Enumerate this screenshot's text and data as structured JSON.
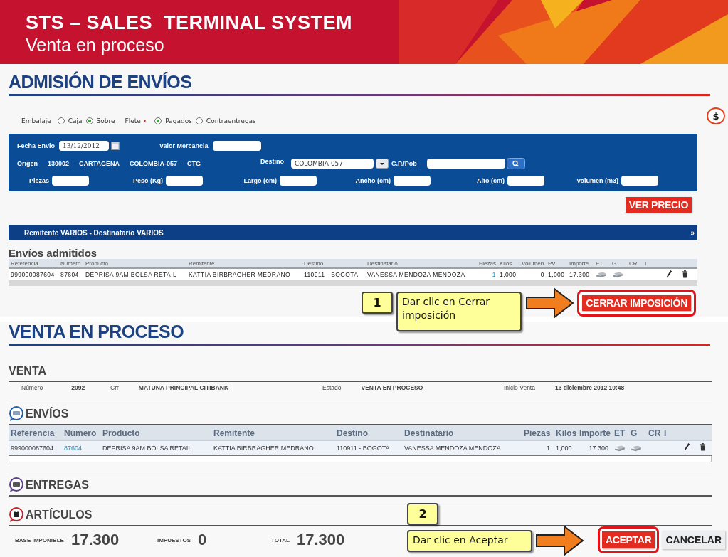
{
  "header": {
    "title": "STS – SALES  TERMINAL SYSTEM",
    "subtitle": "Venta en proceso"
  },
  "admision": {
    "heading": "ADMISIÓN DE ENVÍOS",
    "options": [
      {
        "label": "Embalaje",
        "choices": [
          {
            "label": "Caja",
            "selected": false
          },
          {
            "label": "Sobre",
            "selected": true
          }
        ]
      },
      {
        "label": "Flete",
        "marker": "•",
        "choices": [
          {
            "label": "Pagados",
            "selected": true
          },
          {
            "label": "Contraentregas",
            "selected": false
          }
        ]
      }
    ],
    "price_icon": "$",
    "form": {
      "row_1": [
        {
          "kind": "label",
          "text": "Fecha Envio"
        },
        {
          "kind": "date",
          "value": "13/12/2012"
        },
        {
          "kind": "label",
          "text": "Valor Mercancia"
        },
        {
          "kind": "field"
        }
      ],
      "row_2": [
        {
          "kind": "label",
          "text": "Origen"
        },
        {
          "kind": "value",
          "text": "130002"
        },
        {
          "kind": "value",
          "text": "CARTAGENA"
        },
        {
          "kind": "value",
          "text": "COLOMBIA-057"
        },
        {
          "kind": "value",
          "text": "CTG"
        },
        {
          "kind": "label",
          "text": "Destino"
        },
        {
          "kind": "dropdown",
          "value": "COLOMBIA-057"
        },
        {
          "kind": "label",
          "text": "C.P./Pob"
        },
        {
          "kind": "field"
        },
        {
          "kind": "search"
        }
      ],
      "measures": [
        {
          "label": "Piezas"
        },
        {
          "label": "Peso (Kg)"
        },
        {
          "label": "Largo (cm)"
        },
        {
          "label": "Ancho (cm)"
        },
        {
          "label": "Alto (cm)"
        },
        {
          "label": "Volumen (m3)"
        }
      ]
    },
    "price_button": "VER PRECIO",
    "party_bar": {
      "text": "Remitente VARIOS - Destinatario VARIOS",
      "expand": "»"
    },
    "admitted": {
      "heading": "Envíos admitidos",
      "columns": [
        "Referencia",
        "Número",
        "Producto",
        "Remitente",
        "Destino",
        "Destinatario",
        "Piezas",
        "Kilos",
        "Volumen",
        "PV",
        "Importe",
        "ET",
        "G",
        "CR",
        "I"
      ],
      "rows": [
        {
          "cells": [
            "999000087604",
            "87604",
            "DEPRISA 9AM BOLSA RETAIL",
            "KATTIA BIRBRAGHER MEDRANO",
            "110911 - BOGOTA",
            "VANESSA MENDOZA MENDOZA",
            {
              "text": "1",
              "kind": "link"
            },
            "1,000",
            "0",
            "1,000",
            "17.300"
          ]
        }
      ]
    },
    "close_button": "CERRAR IMPOSICIÓN"
  },
  "venta_en_proceso": {
    "heading": "VENTA EN PROCESO",
    "venta": {
      "heading": "VENTA",
      "fields": [
        {
          "label": "Número",
          "value": "2092"
        },
        {
          "label": "Crr",
          "value": "MATUNA PRINCIPAL CITIBANK"
        },
        {
          "label": "Estado",
          "value": "VENTA EN PROCESO"
        },
        {
          "label": "Inicio Venta",
          "value": "13 diciembre 2012 10:48"
        }
      ]
    },
    "envios": {
      "heading": "ENVÍOS",
      "columns": [
        "Referencia",
        "Número",
        "Producto",
        "Remitente",
        "Destino",
        "Destinatario",
        "Piezas",
        "Kilos",
        "Importe",
        "ET",
        "G",
        "CR",
        "I"
      ],
      "rows": [
        {
          "cells": [
            "999000087604",
            {
              "text": "87604",
              "kind": "link"
            },
            "DEPRISA 9AM BOLSA RETAIL",
            "KATTIA BIRBRAGHER MEDRANO",
            "110911 - BOGOTA",
            "VANESSA MENDOZA MENDOZA",
            "1",
            "1,000",
            "17.300"
          ]
        }
      ]
    },
    "entregas": {
      "heading": "ENTREGAS"
    },
    "articulos": {
      "heading": "ARTÍCULOS"
    },
    "totals": [
      {
        "label": "BASE IMPONIBLE",
        "value": "17.300"
      },
      {
        "label": "IMPUESTOS",
        "value": "0"
      },
      {
        "label": "TOTAL",
        "value": "17.300"
      }
    ],
    "buttons": [
      {
        "label": "ACEPTAR",
        "kind": "primary",
        "highlighted": true
      },
      {
        "label": "CANCELAR",
        "kind": "secondary",
        "highlighted": false
      }
    ]
  },
  "callouts": [
    {
      "step": "1",
      "text": "Dar clic en Cerrar imposición"
    },
    {
      "step": "2",
      "text": "Dar clic en Aceptar"
    }
  ]
}
